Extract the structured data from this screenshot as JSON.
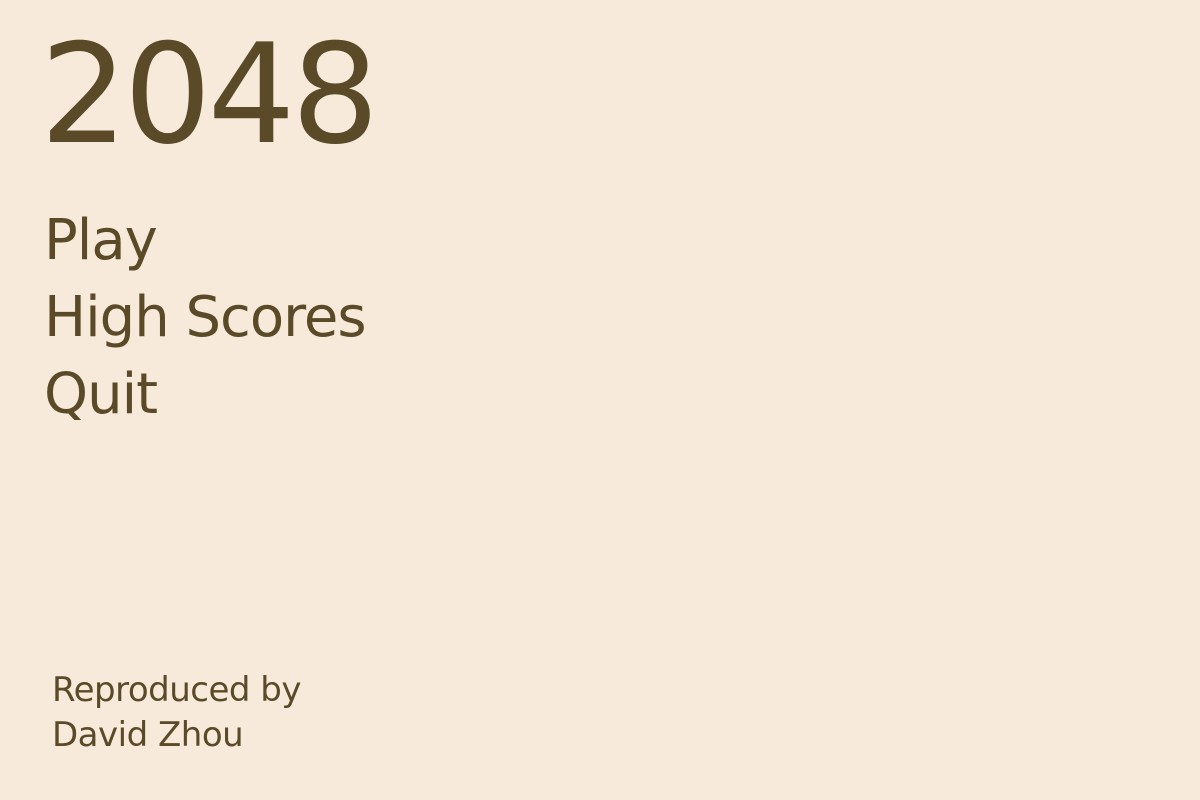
{
  "game": {
    "title": "2048"
  },
  "menu": {
    "items": [
      {
        "label": "Play"
      },
      {
        "label": "High Scores"
      },
      {
        "label": "Quit"
      }
    ]
  },
  "credits": {
    "line1": "Reproduced by",
    "line2": "David Zhou"
  },
  "colors": {
    "background": "#f7eada",
    "text": "#5a4a28"
  }
}
